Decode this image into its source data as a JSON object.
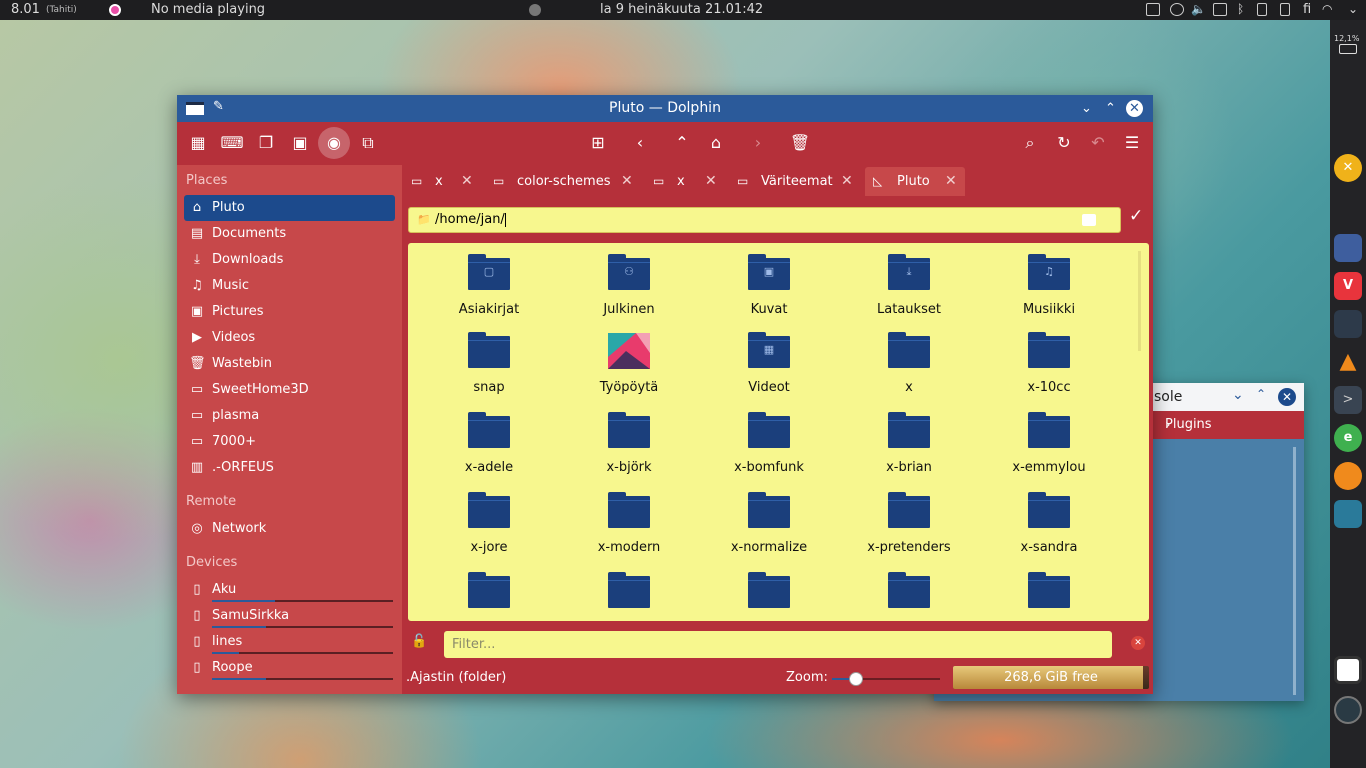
{
  "top_panel": {
    "time": "8.01",
    "timezone": "(Tahiti)",
    "media": "No media playing",
    "datetime": "la 9 heinäkuuta 21.01:42",
    "keyboard_layout": "fi"
  },
  "dock": {
    "battery_percent": "12,1%"
  },
  "window": {
    "title": "Pluto — Dolphin"
  },
  "sidebar": {
    "places_header": "Places",
    "places": [
      {
        "label": "Pluto",
        "icon": "home-icon"
      },
      {
        "label": "Documents",
        "icon": "documents-icon"
      },
      {
        "label": "Downloads",
        "icon": "downloads-icon"
      },
      {
        "label": "Music",
        "icon": "music-icon"
      },
      {
        "label": "Pictures",
        "icon": "pictures-icon"
      },
      {
        "label": "Videos",
        "icon": "videos-icon"
      },
      {
        "label": "Wastebin",
        "icon": "trash-icon"
      },
      {
        "label": "SweetHome3D",
        "icon": "folder-icon"
      },
      {
        "label": "plasma",
        "icon": "folder-icon"
      },
      {
        "label": "7000+",
        "icon": "folder-icon"
      },
      {
        "label": ".-ORFEUS",
        "icon": "archive-icon"
      }
    ],
    "remote_header": "Remote",
    "remote": [
      {
        "label": "Network",
        "icon": "network-icon"
      }
    ],
    "devices_header": "Devices",
    "devices": [
      {
        "label": "Aku",
        "usage": 0.35
      },
      {
        "label": "SamuSirkka",
        "usage": 0.3
      },
      {
        "label": "lines",
        "usage": 0.15
      },
      {
        "label": "Roope",
        "usage": 0.3
      }
    ]
  },
  "tabs": [
    {
      "label": "x"
    },
    {
      "label": "color-schemes"
    },
    {
      "label": "x"
    },
    {
      "label": "Väriteemat"
    },
    {
      "label": "Pluto"
    }
  ],
  "location": {
    "path": "/home/jan/"
  },
  "files": [
    {
      "name": "Asiakirjat",
      "emblem": "document-emblem-icon"
    },
    {
      "name": "Julkinen",
      "emblem": "public-emblem-icon"
    },
    {
      "name": "Kuvat",
      "emblem": "pictures-emblem-icon"
    },
    {
      "name": "Lataukset",
      "emblem": "download-emblem-icon"
    },
    {
      "name": "Musiikki",
      "emblem": "music-emblem-icon"
    },
    {
      "name": "snap",
      "emblem": ""
    },
    {
      "name": "Työpöytä",
      "emblem": "desktop-thumbnail"
    },
    {
      "name": "Videot",
      "emblem": "video-emblem-icon"
    },
    {
      "name": "x",
      "emblem": ""
    },
    {
      "name": "x-10cc",
      "emblem": ""
    },
    {
      "name": "x-adele",
      "emblem": ""
    },
    {
      "name": "x-björk",
      "emblem": ""
    },
    {
      "name": "x-bomfunk",
      "emblem": ""
    },
    {
      "name": "x-brian",
      "emblem": ""
    },
    {
      "name": "x-emmylou",
      "emblem": ""
    },
    {
      "name": "x-jore",
      "emblem": ""
    },
    {
      "name": "x-modern",
      "emblem": ""
    },
    {
      "name": "x-normalize",
      "emblem": ""
    },
    {
      "name": "x-pretenders",
      "emblem": ""
    },
    {
      "name": "x-sandra",
      "emblem": ""
    },
    {
      "name": "",
      "emblem": ""
    },
    {
      "name": "",
      "emblem": ""
    },
    {
      "name": "",
      "emblem": ""
    },
    {
      "name": "",
      "emblem": ""
    },
    {
      "name": "",
      "emblem": ""
    }
  ],
  "filter": {
    "placeholder": "Filter..."
  },
  "status": {
    "selection": ".Ajastin (folder)",
    "zoom_label": "Zoom:",
    "zoom_level": 0.22,
    "free_space": "268,6 GiB free",
    "used_fraction": 0.97
  },
  "background_window": {
    "title_fragment": "sole",
    "panel_label": "Plugins"
  },
  "colors": {
    "accent_red": "#b5303a",
    "sidebar_red": "#c7484a",
    "titlebar_blue": "#2b5a9a",
    "folder_blue": "#1b3f7c",
    "view_yellow": "#f7f78e"
  }
}
